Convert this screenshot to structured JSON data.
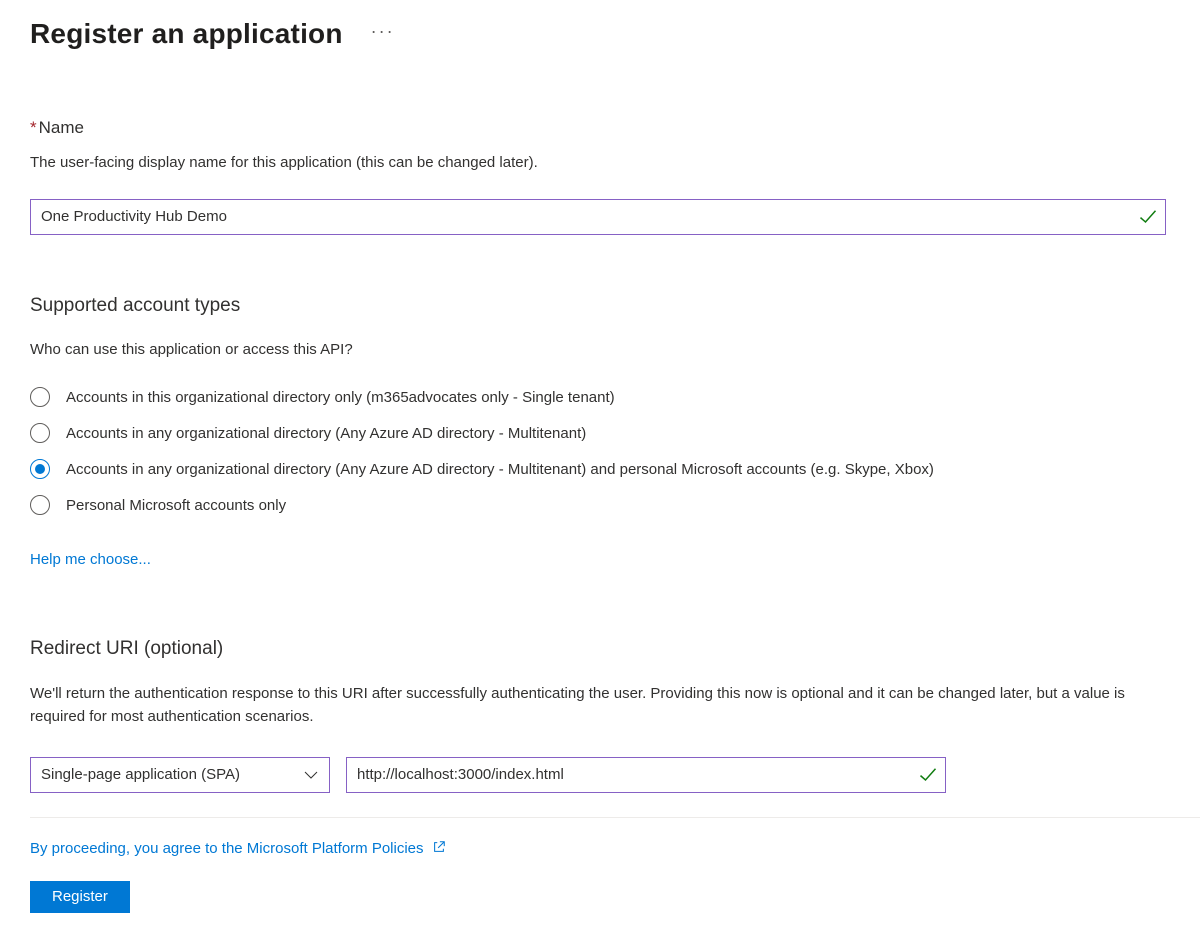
{
  "page": {
    "title": "Register an application"
  },
  "name_section": {
    "label": "Name",
    "help": "The user-facing display name for this application (this can be changed later).",
    "value": "One Productivity Hub Demo"
  },
  "account_types": {
    "title": "Supported account types",
    "help": "Who can use this application or access this API?",
    "options": [
      "Accounts in this organizational directory only (m365advocates only - Single tenant)",
      "Accounts in any organizational directory (Any Azure AD directory - Multitenant)",
      "Accounts in any organizational directory (Any Azure AD directory - Multitenant) and personal Microsoft accounts (e.g. Skype, Xbox)",
      "Personal Microsoft accounts only"
    ],
    "selected_index": 2,
    "help_link": "Help me choose..."
  },
  "redirect": {
    "title": "Redirect URI (optional)",
    "help": "We'll return the authentication response to this URI after successfully authenticating the user. Providing this now is optional and it can be changed later, but a value is required for most authentication scenarios.",
    "platform_selected": "Single-page application (SPA)",
    "uri_value": "http://localhost:3000/index.html"
  },
  "footer": {
    "policy_text": "By proceeding, you agree to the Microsoft Platform Policies",
    "register_label": "Register"
  },
  "colors": {
    "primary": "#0078d4",
    "input_border": "#8661c5",
    "success": "#107c10",
    "required": "#a4262c"
  }
}
